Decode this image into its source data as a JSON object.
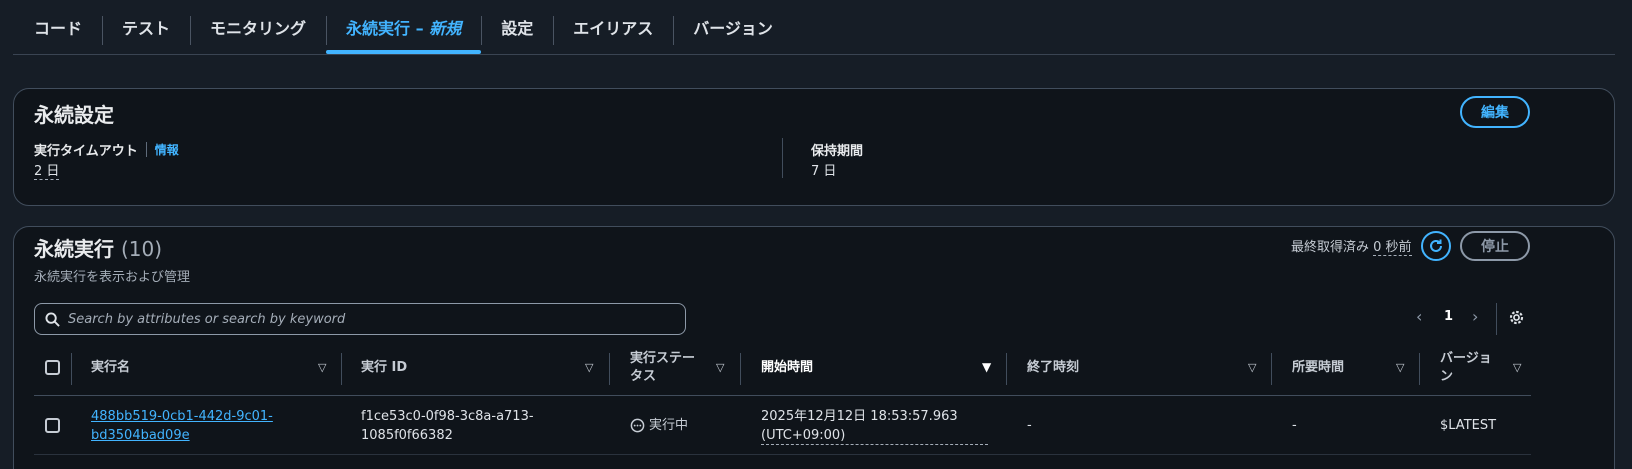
{
  "tabs": [
    {
      "label": "コード"
    },
    {
      "label": "テスト"
    },
    {
      "label": "モニタリング"
    },
    {
      "label": "永続実行 – ",
      "label_em": "新規",
      "active": true
    },
    {
      "label": "設定"
    },
    {
      "label": "エイリアス"
    },
    {
      "label": "バージョン"
    }
  ],
  "durable_settings": {
    "title": "永続設定",
    "edit_label": "編集",
    "timeout_label": "実行タイムアウト",
    "info_label": "情報",
    "timeout_value": "2 日",
    "retention_label": "保持期間",
    "retention_value": "7 日"
  },
  "executions": {
    "title": "永続実行",
    "count": "(10)",
    "description": "永続実行を表示および管理",
    "last_fetched_prefix": "最終取得済み",
    "last_fetched_value": "0 秒前",
    "stop_label": "停止",
    "search_placeholder": "Search by attributes or search by keyword",
    "page": "1",
    "columns": {
      "name": "実行名",
      "id": "実行 ID",
      "status": "実行ステータス",
      "start": "開始時間",
      "end": "終了時刻",
      "duration": "所要時間",
      "version": "バージョン"
    },
    "rows": [
      {
        "name_line1": "488bb519-0cb1-442d-9c01-",
        "name_line2": "bd3504bad09e",
        "id_line1": "f1ce53c0-0f98-3c8a-a713-",
        "id_line2": "1085f0f66382",
        "status": "実行中",
        "start_line1": "2025年12月12日 18:53:57.963",
        "start_line2": "(UTC+09:00)",
        "end": "-",
        "duration": "-",
        "version": "$LATEST"
      }
    ]
  },
  "colors": {
    "accent": "#42b4ff",
    "background": "#161d26",
    "panel": "#0f141a",
    "border": "#414d5c"
  }
}
